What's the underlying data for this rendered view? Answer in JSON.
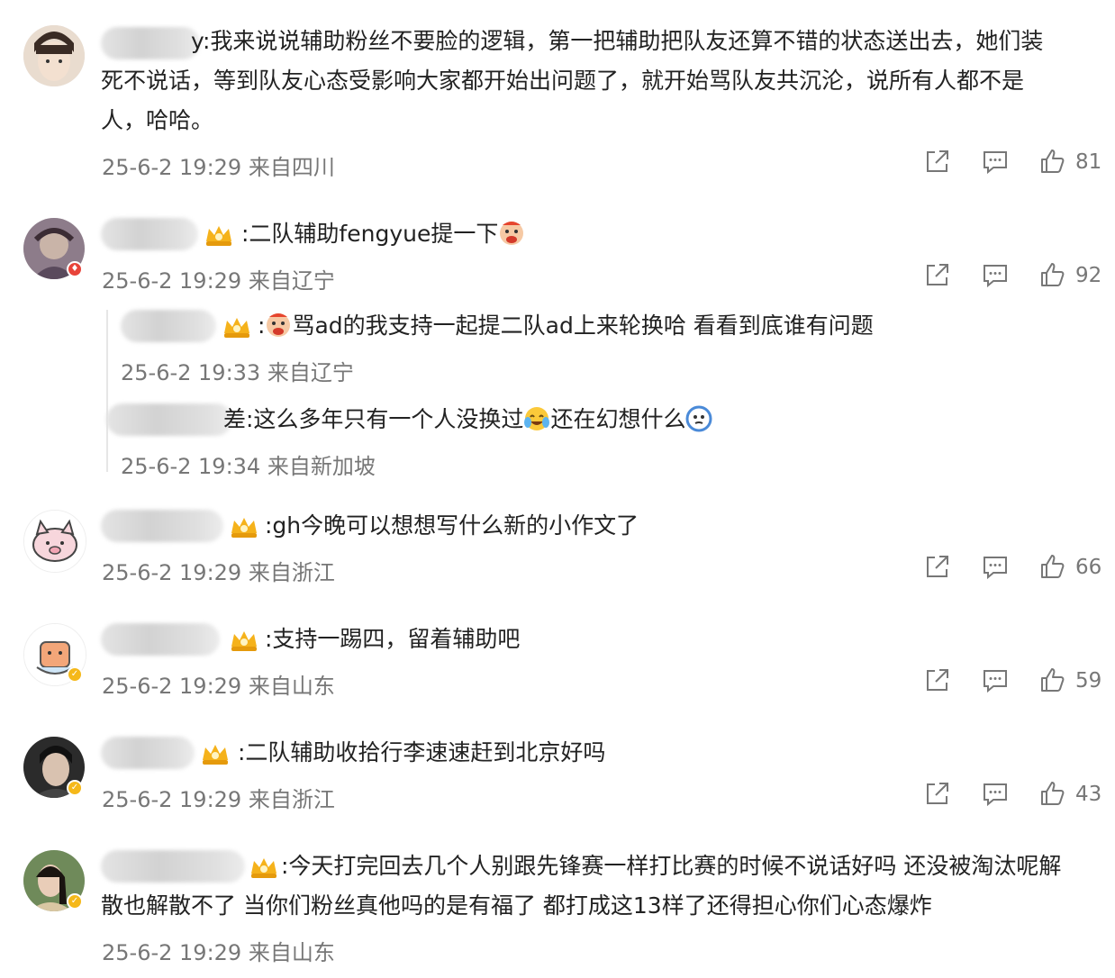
{
  "comments": [
    {
      "text_lines": [
        "y:我来说说辅助粉丝不要脸的逻辑，第一把辅助把队友还算不错的状态送出去，她们装",
        "死不说话，等到队友心态受影响大家都开始出问题了，就开始骂队友共沉沦，说所有人都不是",
        "人，哈哈。"
      ],
      "meta": "25-6-2 19:29 来自四川",
      "likes": "81"
    },
    {
      "text_prefix": ":二队辅助fengyue提一下",
      "meta": "25-6-2 19:29 来自辽宁",
      "likes": "92",
      "replies": [
        {
          "text_prefix": ":",
          "text_after": "骂ad的我支持一起提二队ad上来轮换哈 看看到底谁有问题",
          "meta": "25-6-2 19:33 来自辽宁"
        },
        {
          "text_prefix": "差:这么多年只有一个人没换过",
          "text_after": "还在幻想什么",
          "meta": "25-6-2 19:34 来自新加坡"
        }
      ]
    },
    {
      "text_prefix": ":gh今晚可以想想写什么新的小作文了",
      "meta": "25-6-2 19:29 来自浙江",
      "likes": "66"
    },
    {
      "text_prefix": ":支持一踢四，留着辅助吧",
      "meta": "25-6-2 19:29 来自山东",
      "likes": "59"
    },
    {
      "text_prefix": ":二队辅助收拾行李速速赶到北京好吗",
      "meta": "25-6-2 19:29 来自浙江",
      "likes": "43"
    },
    {
      "text_lines": [
        ":今天打完回去几个人别跟先锋赛一样打比赛的时候不说话好吗 还没被淘汰呢解",
        "散也解散不了 当你们粉丝真他吗的是有福了 都打成这13样了还得担心你们心态爆炸"
      ],
      "meta": "25-6-2 19:29 来自山东"
    }
  ],
  "icons": {
    "share": "share-icon",
    "comment": "comment-icon",
    "like": "thumbs-up-icon",
    "crown": "fan-crown-icon",
    "emoji_cry": "crying-emoji-icon",
    "emoji_laugh_cry": "laughing-crying-emoji-icon",
    "emoji_think": "thinking-emoji-icon"
  }
}
